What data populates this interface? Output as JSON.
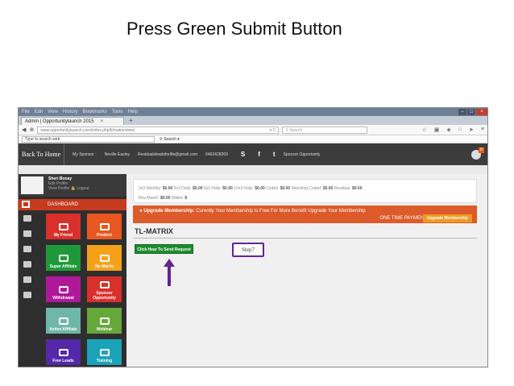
{
  "slide": {
    "title": "Press Green Submit Button"
  },
  "window": {
    "menu": [
      "File",
      "Edit",
      "View",
      "History",
      "Bookmarks",
      "Tools",
      "Help"
    ],
    "controls": [
      "–",
      "□",
      "×"
    ]
  },
  "browser": {
    "tab_title": "Admin | Opportunitylaunch 2015",
    "tab_close": "×",
    "new_tab": "+",
    "url": "www.opportunitylaunch.com/index.php/tl/matrix/view/",
    "search_placeholder": "Search",
    "toolbar_search_value": "Type to search web",
    "toolbar_search_button": "Search"
  },
  "topnav": {
    "home": "Back To Home",
    "sponsor_label": "My Sponsor :",
    "sponsor_name": "Neville Easley",
    "email": "Residualsleadsforlife@gmail.com",
    "phone": "6462428269",
    "social": [
      "S",
      "f",
      "t"
    ],
    "opportunity": "Sponsor Opportunity",
    "notif_count": "0"
  },
  "sidebar": {
    "user_name": "Sheri Bonay",
    "edit_profile": "Edit Profile",
    "view_profile": "View Profile",
    "logout": "Logout",
    "dashboard": "DASHBOARD",
    "tiles": [
      {
        "label": "My Friend",
        "color": "#d9302c"
      },
      {
        "label": "Product",
        "color": "#e8571f"
      },
      {
        "label": "Super Affiliate",
        "color": "#1e9a3a"
      },
      {
        "label": "My Matrix",
        "color": "#f5a21a"
      },
      {
        "label": "Withdrawal",
        "color": "#b0189a"
      },
      {
        "label": "Sponsor Opportunity",
        "color": "#d9302c"
      },
      {
        "label": "Active Affiliate",
        "color": "#6fb7a8"
      },
      {
        "label": "Webinar",
        "color": "#67a83a"
      },
      {
        "label": "Free Leads",
        "color": "#5428a8"
      },
      {
        "label": "Training",
        "color": "#1aa3b8"
      }
    ]
  },
  "stats": {
    "line1": [
      {
        "label": "3x3 Monthly:",
        "value": "$0.00"
      },
      {
        "label": "3x3 Daily:",
        "value": "$0.00"
      },
      {
        "label": "5x3 Daily:",
        "value": "$0.00"
      },
      {
        "label": "10x3 Daily:",
        "value": "$0.00"
      },
      {
        "label": "Coded:",
        "value": "$0.00"
      },
      {
        "label": "Matching Coded:",
        "value": "$0.00"
      },
      {
        "label": "Residual:",
        "value": "$0.00"
      }
    ],
    "line2": [
      {
        "label": "Rev-Match:",
        "value": "$0.00"
      },
      {
        "label": "Wallet:",
        "value": "$"
      }
    ]
  },
  "upgrade": {
    "heading": "Upgrade Membership:",
    "text": "Curently Your Membership Is Free For More Benefit Upgrade Your Membership",
    "one_time": "ONE TIME PAYMENT",
    "button": "Upgrade Membership"
  },
  "main": {
    "title": "TL-MATRIX",
    "send_button": "Click Hear To Send Request",
    "step_label": "Step7",
    "accent": "#5e2596"
  }
}
